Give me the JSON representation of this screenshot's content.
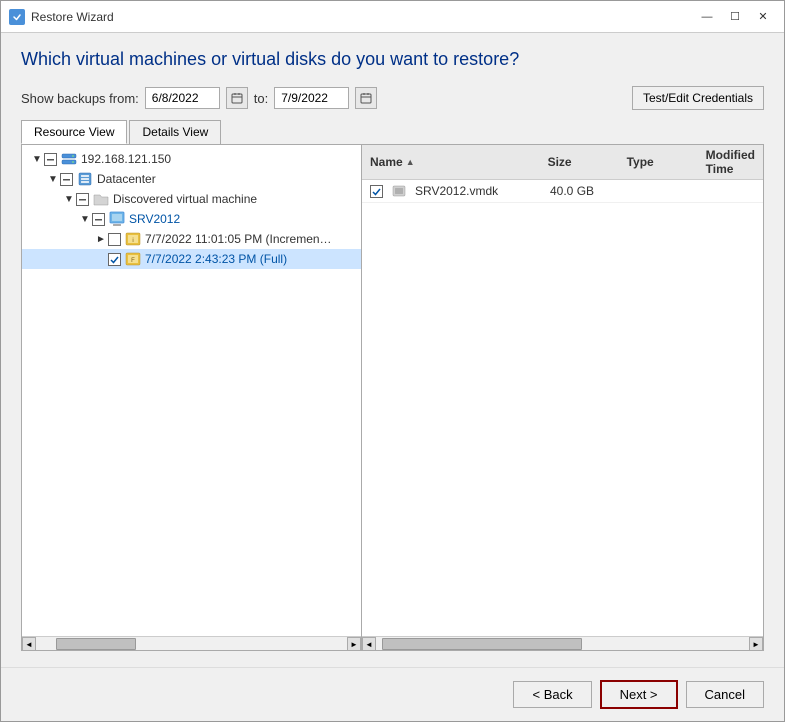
{
  "window": {
    "title": "Restore Wizard",
    "icon": "🔄"
  },
  "title_bar_buttons": {
    "minimize": "—",
    "maximize": "☐",
    "close": "✕"
  },
  "page": {
    "title": "Which virtual machines or virtual disks do you want to restore?"
  },
  "filter": {
    "show_label": "Show backups from:",
    "from_date": "6/8/2022",
    "to_label": "to:",
    "to_date": "7/9/2022",
    "credentials_btn": "Test/Edit Credentials"
  },
  "tabs": {
    "resource_view": "Resource View",
    "details_view": "Details View"
  },
  "tree": {
    "items": [
      {
        "id": "server",
        "label": "192.168.121.150",
        "indent": "indent1",
        "expand": "▼",
        "checkbox": "partial",
        "icon": "server"
      },
      {
        "id": "datacenter",
        "label": "Datacenter",
        "indent": "indent2",
        "expand": "▼",
        "checkbox": "partial",
        "icon": "datacenter"
      },
      {
        "id": "discovered",
        "label": "Discovered virtual machine",
        "indent": "indent3",
        "expand": "▼",
        "checkbox": "partial",
        "icon": "folder"
      },
      {
        "id": "srv2012",
        "label": "SRV2012",
        "indent": "indent4",
        "expand": "▼",
        "checkbox": "partial",
        "icon": "vm"
      },
      {
        "id": "backup_incr",
        "label": "7/7/2022 11:01:05 PM (Incremen…",
        "indent": "indent5",
        "expand": "►",
        "checkbox": "unchecked",
        "icon": "backup_incr"
      },
      {
        "id": "backup_full",
        "label": "7/7/2022 2:43:23 PM (Full)",
        "indent": "indent5",
        "expand": "",
        "checkbox": "checked",
        "icon": "backup_full"
      }
    ]
  },
  "detail_columns": {
    "name": "Name",
    "size": "Size",
    "type": "Type",
    "modified_time": "Modified Time"
  },
  "detail_rows": [
    {
      "name": "SRV2012.vmdk",
      "size": "40.0 GB",
      "type": "",
      "modified_time": "",
      "checked": true,
      "icon": "disk"
    }
  ],
  "footer": {
    "back_btn": "< Back",
    "next_btn": "Next >",
    "cancel_btn": "Cancel"
  }
}
